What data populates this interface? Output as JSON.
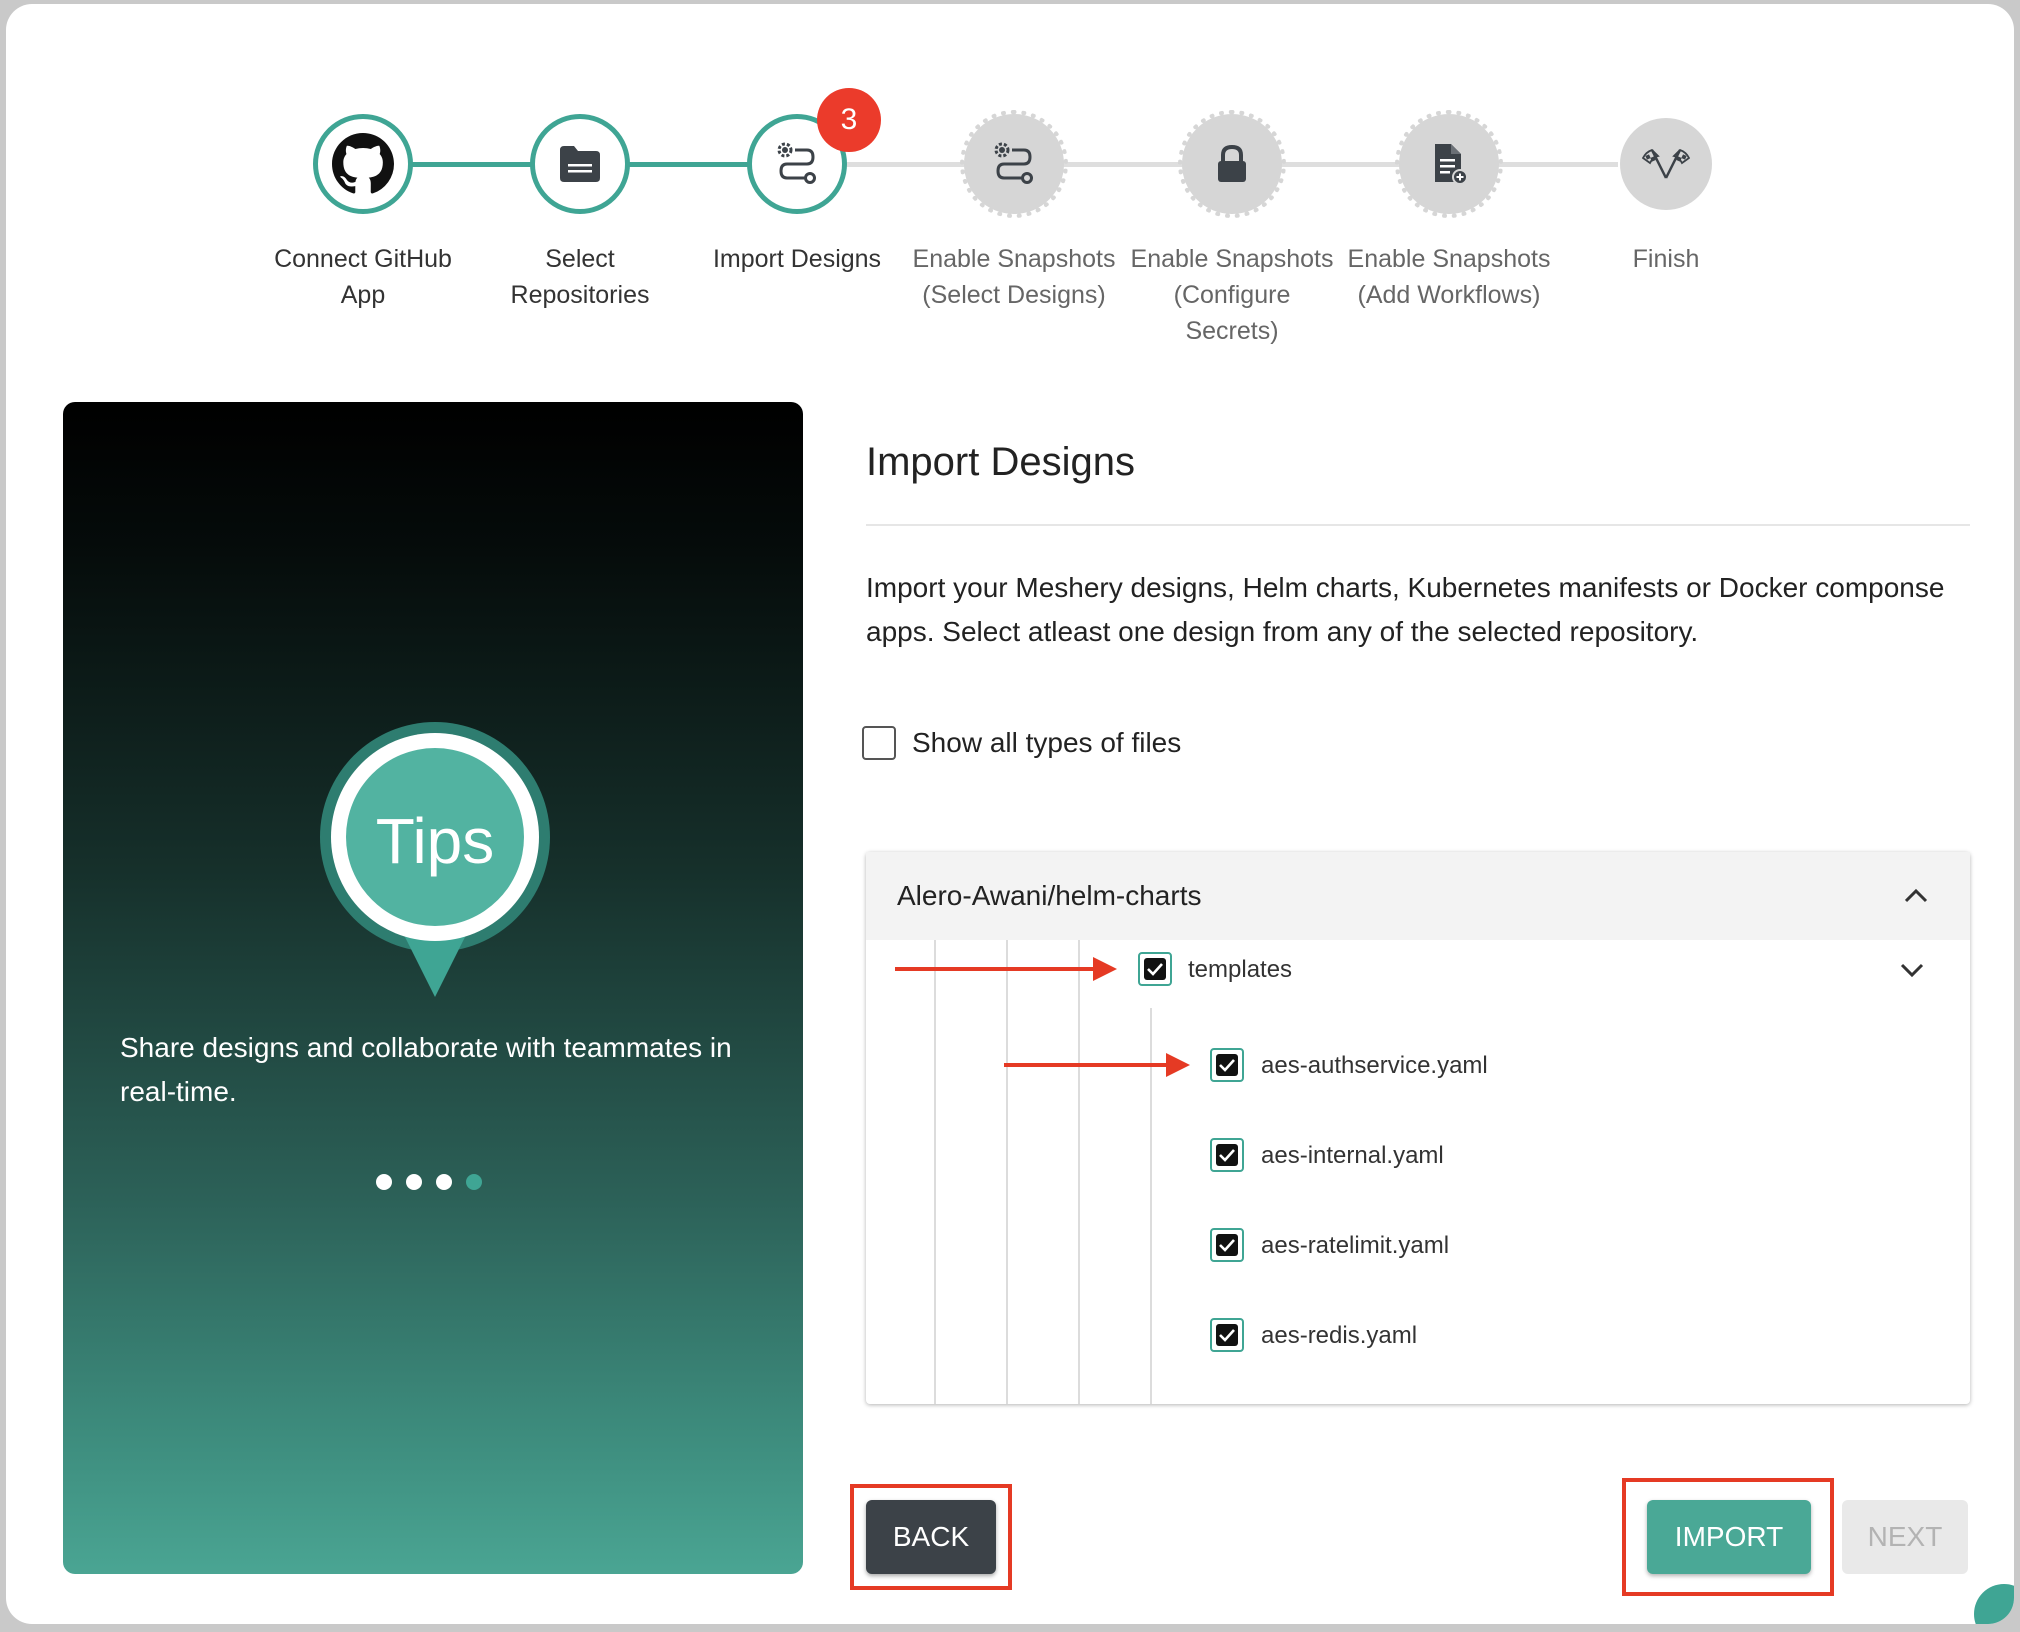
{
  "stepper": {
    "steps": [
      {
        "label_line1": "Connect GitHub",
        "label_line2": "App",
        "label_line3": "",
        "icon": "github-icon",
        "status": "done"
      },
      {
        "label_line1": "Select",
        "label_line2": "Repositories",
        "label_line3": "",
        "icon": "folder-icon",
        "status": "done"
      },
      {
        "label_line1": "Import Designs",
        "label_line2": "",
        "label_line3": "",
        "icon": "design-flow-icon",
        "status": "active",
        "badge": "3"
      },
      {
        "label_line1": "Enable Snapshots",
        "label_line2": "(Select Designs)",
        "label_line3": "",
        "icon": "design-flow-icon",
        "status": "pending"
      },
      {
        "label_line1": "Enable Snapshots",
        "label_line2": "(Configure",
        "label_line3": "Secrets)",
        "icon": "lock-icon",
        "status": "pending"
      },
      {
        "label_line1": "Enable Snapshots",
        "label_line2": "(Add Workflows)",
        "label_line3": "",
        "icon": "document-add-icon",
        "status": "pending"
      },
      {
        "label_line1": "Finish",
        "label_line2": "",
        "label_line3": "",
        "icon": "checkered-flags-icon",
        "status": "pending"
      }
    ]
  },
  "tips": {
    "bubble_text": "Tips",
    "message": "Share designs and collaborate with teammates in real-time.",
    "carousel_count": 4,
    "carousel_active": 4
  },
  "main": {
    "title": "Import Designs",
    "description": "Import your Meshery designs, Helm charts, Kubernetes manifests or Docker componse apps. Select atleast one design from any of the selected repository.",
    "show_all_label": "Show all types of files",
    "show_all_checked": false
  },
  "tree": {
    "repo": "Alero-Awani/helm-charts",
    "folder": {
      "name": "templates",
      "checked": true
    },
    "files": [
      {
        "name": "aes-authservice.yaml",
        "checked": true
      },
      {
        "name": "aes-internal.yaml",
        "checked": true
      },
      {
        "name": "aes-ratelimit.yaml",
        "checked": true
      },
      {
        "name": "aes-redis.yaml",
        "checked": true
      }
    ]
  },
  "buttons": {
    "back": "BACK",
    "import": "IMPORT",
    "next": "NEXT"
  },
  "colors": {
    "accent": "#3fa594",
    "highlight": "#e53a24",
    "badge": "#eb3b2b",
    "dark_button": "#3c4248"
  }
}
